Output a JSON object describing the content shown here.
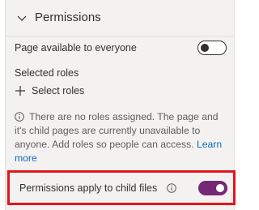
{
  "panel": {
    "title": "Permissions",
    "page_available_label": "Page available to everyone",
    "page_available_enabled": false,
    "selected_roles_label": "Selected roles",
    "add_roles_label": "Select roles",
    "info_message": "There are no roles assigned. The page and it's child pages are currently unavailable to anyone. Add roles so people can access.",
    "learn_more_label": "Learn more",
    "child_files_label": "Permissions apply to child files",
    "child_files_enabled": true
  },
  "colors": {
    "panel_background": "#f3f2f1",
    "toggle_on": "#742774",
    "link": "#0f6cbd",
    "highlight": "#e3151b"
  },
  "icons": [
    "chevron-down-icon",
    "plus-icon",
    "info-icon"
  ]
}
